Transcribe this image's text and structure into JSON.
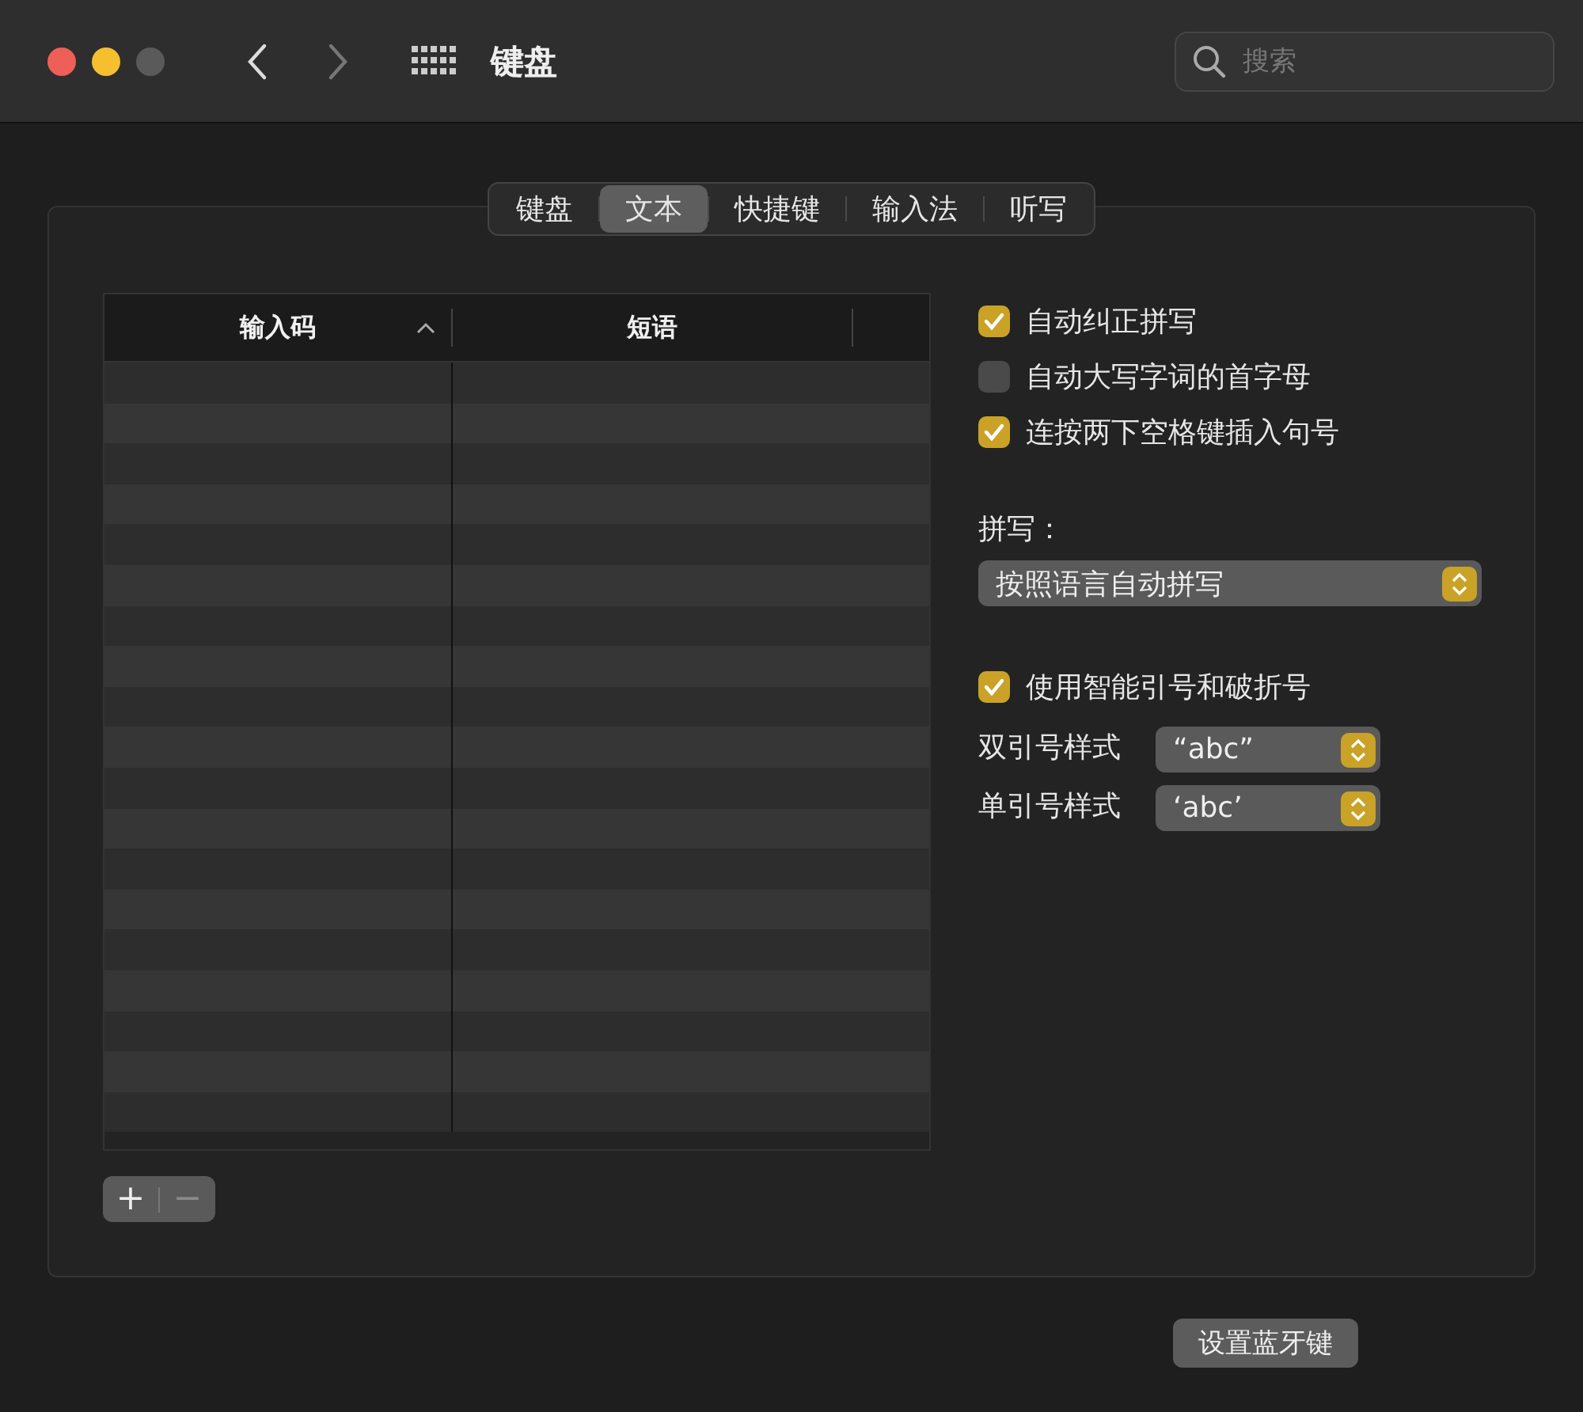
{
  "window": {
    "title": "键盘",
    "search": {
      "placeholder": "搜索"
    }
  },
  "tabs": [
    {
      "label": "键盘",
      "selected": false
    },
    {
      "label": "文本",
      "selected": true
    },
    {
      "label": "快捷键",
      "selected": false
    },
    {
      "label": "输入法",
      "selected": false
    },
    {
      "label": "听写",
      "selected": false
    }
  ],
  "table": {
    "columns": [
      {
        "label": "输入码",
        "sorted": true
      },
      {
        "label": "短语",
        "sorted": false
      }
    ]
  },
  "table_buttons": [
    {
      "label": "+",
      "disabled": false
    },
    {
      "label": "−",
      "disabled": true
    }
  ],
  "options": [
    {
      "label": "自动纠正拼写",
      "checked": true
    },
    {
      "label": "自动大写字词的首字母",
      "checked": false
    },
    {
      "label": "连按两下空格键插入句号",
      "checked": true
    }
  ],
  "spelling": {
    "label": "拼写：",
    "value": "按照语言自动拼写"
  },
  "smart_quotes": {
    "label": "使用智能引号和破折号",
    "checked": true
  },
  "quote_styles": [
    {
      "label": "双引号样式",
      "value": "“abc”"
    },
    {
      "label": "单引号样式",
      "value": "‘abc’"
    }
  ],
  "bottom_button": {
    "label": "设置蓝牙键"
  }
}
